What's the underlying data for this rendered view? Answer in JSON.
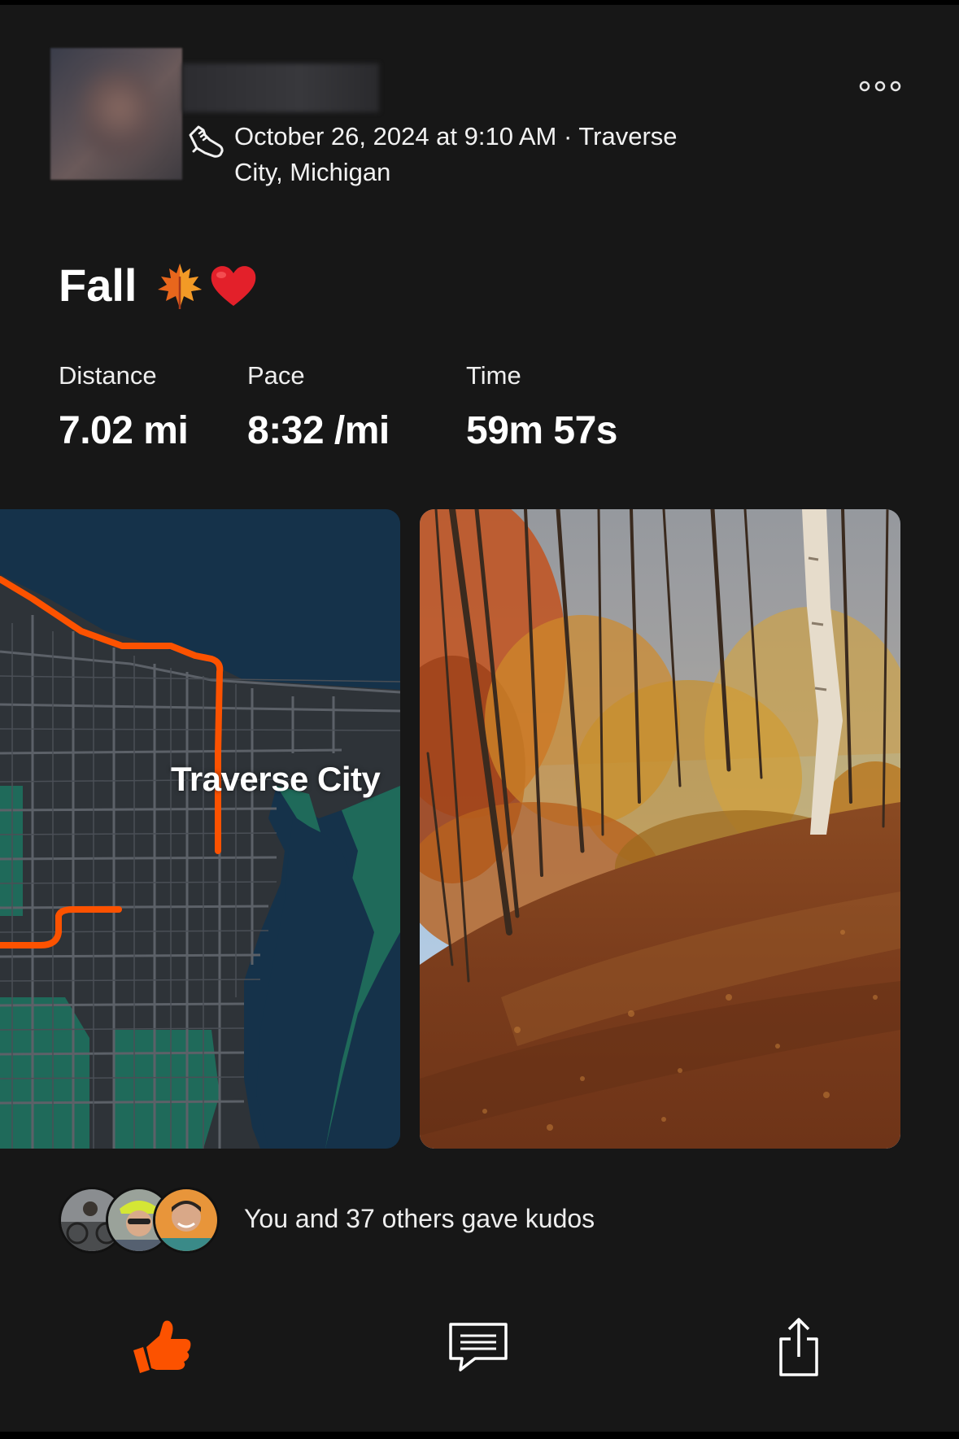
{
  "post": {
    "meta": "October 26, 2024 at 9:10 AM · Traverse City, Michigan",
    "title": "Fall",
    "title_emojis": [
      "maple-leaf-icon",
      "red-heart-icon"
    ],
    "activity_icon": "running-shoe-icon",
    "more_icon": "more-options-icon"
  },
  "stats": [
    {
      "label": "Distance",
      "value": "7.02 mi"
    },
    {
      "label": "Pace",
      "value": "8:32 /mi"
    },
    {
      "label": "Time",
      "value": "59m 57s"
    }
  ],
  "map": {
    "label": "Traverse City",
    "route_color": "#fc5200"
  },
  "kudos": {
    "text": "You and 37 others gave kudos"
  },
  "actions": {
    "kudos_icon": "thumbs-up-icon",
    "comment_icon": "comment-icon",
    "share_icon": "share-icon",
    "accent": "#fc5200"
  }
}
